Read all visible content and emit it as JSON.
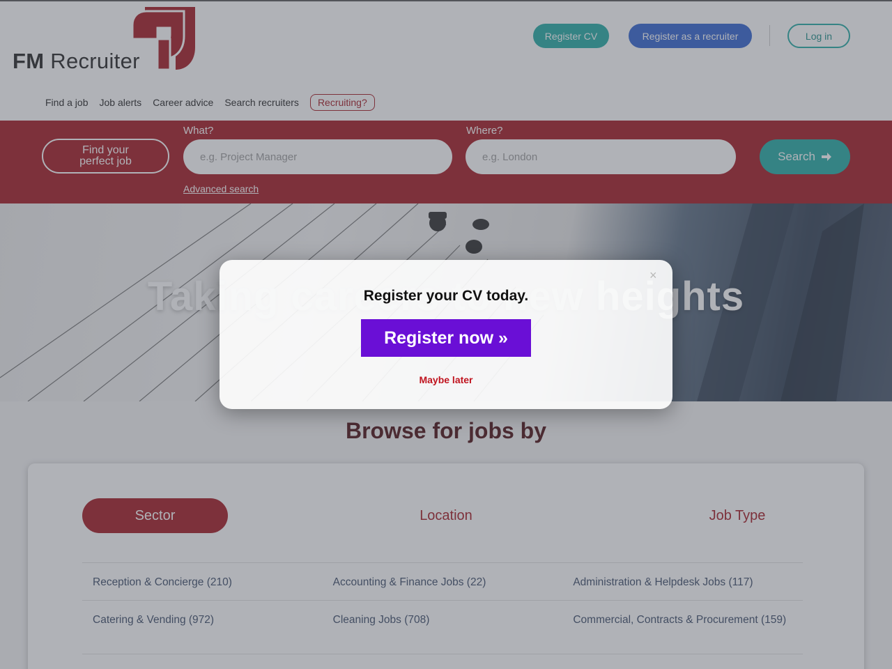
{
  "header": {
    "logo_bold": "FM",
    "logo_text": "Recruiter",
    "register_cv": "Register CV",
    "register_recruiter": "Register as a recruiter",
    "login": "Log in"
  },
  "nav": {
    "items": [
      "Find a job",
      "Job alerts",
      "Career advice",
      "Search recruiters"
    ],
    "recruiting": "Recruiting?"
  },
  "search": {
    "find_label": "Find your perfect job",
    "what_label": "What?",
    "what_placeholder": "e.g. Project Manager",
    "where_label": "Where?",
    "where_placeholder": "e.g. London",
    "search_button": "Search",
    "advanced": "Advanced search"
  },
  "hero": {
    "title": "Taking careers to new heights"
  },
  "browse": {
    "title": "Browse for jobs by",
    "tabs": [
      "Sector",
      "Location",
      "Job Type"
    ],
    "rows": [
      [
        "Reception & Concierge (210)",
        "Accounting & Finance Jobs (22)",
        "Administration & Helpdesk Jobs (117)"
      ],
      [
        "Catering & Vending (972)",
        "Cleaning Jobs (708)",
        "Commercial, Contracts & Procurement (159)"
      ]
    ]
  },
  "modal": {
    "close": "×",
    "title": "Register your CV today.",
    "button": "Register now »",
    "maybe_later": "Maybe later"
  },
  "colors": {
    "brand_red": "#a3141e",
    "teal": "#1fa9a2",
    "blue": "#2f62cf",
    "purple": "#6a0fd6"
  }
}
